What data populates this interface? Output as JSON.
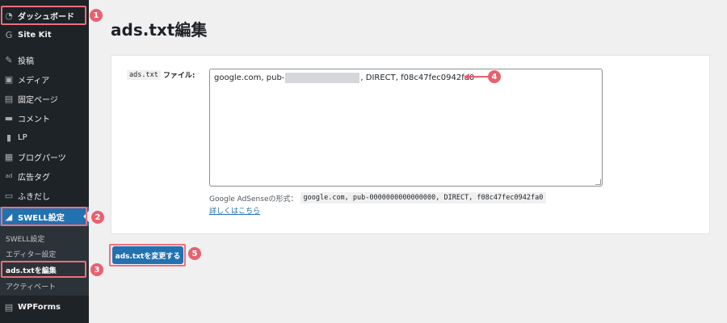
{
  "sidebar": {
    "items": [
      {
        "label": "ダッシュボード",
        "icon": "dashboard-icon",
        "glyph": "◔"
      },
      {
        "label": "Site Kit",
        "icon": "google-g-icon",
        "glyph": "G"
      },
      {
        "label": "投稿",
        "icon": "pin-icon",
        "glyph": "✎"
      },
      {
        "label": "メディア",
        "icon": "media-icon",
        "glyph": "▣"
      },
      {
        "label": "固定ページ",
        "icon": "page-icon",
        "glyph": "▤"
      },
      {
        "label": "コメント",
        "icon": "comment-icon",
        "glyph": "▬"
      },
      {
        "label": "LP",
        "icon": "lp-icon",
        "glyph": "▮"
      },
      {
        "label": "ブログパーツ",
        "icon": "blog-parts-icon",
        "glyph": "▦"
      },
      {
        "label": "広告タグ",
        "icon": "ad-tag-icon",
        "glyph": "ad"
      },
      {
        "label": "ふきだし",
        "icon": "speech-bubble-icon",
        "glyph": "▭"
      },
      {
        "label": "SWELL設定",
        "icon": "swell-icon",
        "glyph": "◢"
      }
    ],
    "submenu": [
      {
        "label": "SWELL設定"
      },
      {
        "label": "エディター設定"
      },
      {
        "label": "ads.txtを編集"
      },
      {
        "label": "アクティベート"
      }
    ],
    "bottom_item": {
      "label": "WPForms",
      "icon": "wpforms-icon",
      "glyph": "▤"
    }
  },
  "page": {
    "title": "ads.txt編集",
    "field_code": "ads.txt",
    "field_label": "ファイル:",
    "textarea_prefix": "google.com, pub-",
    "textarea_suffix": ", DIRECT, f08c47fec0942fa0",
    "hint_text": "Google AdSenseの形式：",
    "hint_code": "google.com, pub-0000000000000000, DIRECT, f08c47fec0942fa0",
    "details_link": "詳しくはこちら",
    "submit_label": "ads.txtを変更する"
  },
  "annotations": {
    "numbers": [
      "1",
      "2",
      "3",
      "4",
      "5"
    ],
    "color": "#e8616e"
  },
  "colors": {
    "sidebar_bg": "#1d2327",
    "accent": "#2271b1",
    "highlight": "#ef6f7b"
  }
}
